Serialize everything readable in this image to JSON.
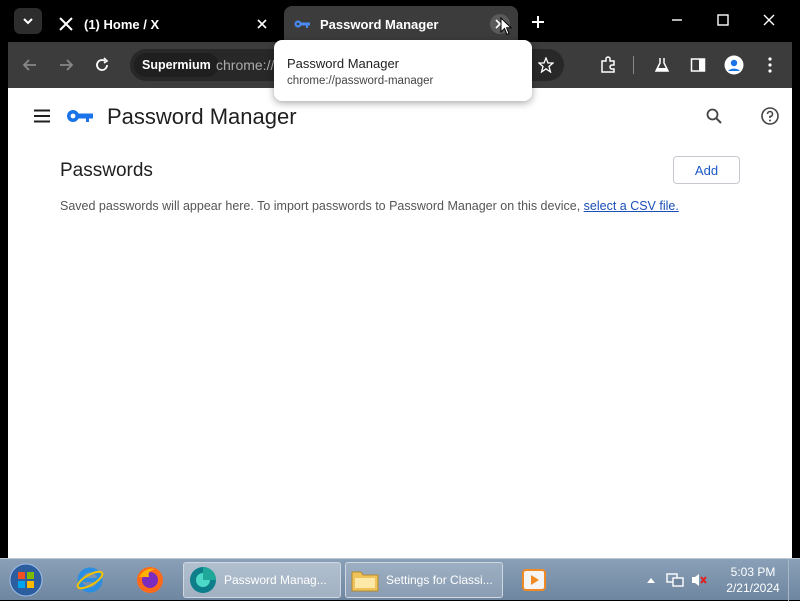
{
  "browser": {
    "tabs": [
      {
        "title": "(1) Home / X",
        "icon": "x-logo-icon",
        "active": false
      },
      {
        "title": "Password Manager",
        "icon": "key-icon",
        "active": true
      }
    ],
    "omnibox": {
      "chip": "Supermium",
      "url": "chrome://"
    },
    "tooltip": {
      "title": "Password Manager",
      "url": "chrome://password-manager"
    }
  },
  "page": {
    "title": "Password Manager",
    "section_title": "Passwords",
    "add_label": "Add",
    "hint_text": "Saved passwords will appear here. To import passwords to Password Manager on this device, ",
    "hint_link": "select a CSV file."
  },
  "taskbar": {
    "tasks": [
      {
        "label": "Password Manag...",
        "icon": "browser-icon",
        "active": true
      },
      {
        "label": "Settings for Classi...",
        "icon": "folder-icon",
        "active": false
      }
    ],
    "clock_time": "5:03 PM",
    "clock_date": "2/21/2024"
  },
  "colors": {
    "accent": "#1a73e8",
    "link": "#1a4fb8",
    "tab_active": "#3c3c3c",
    "toolbar": "#3c3c3c"
  }
}
